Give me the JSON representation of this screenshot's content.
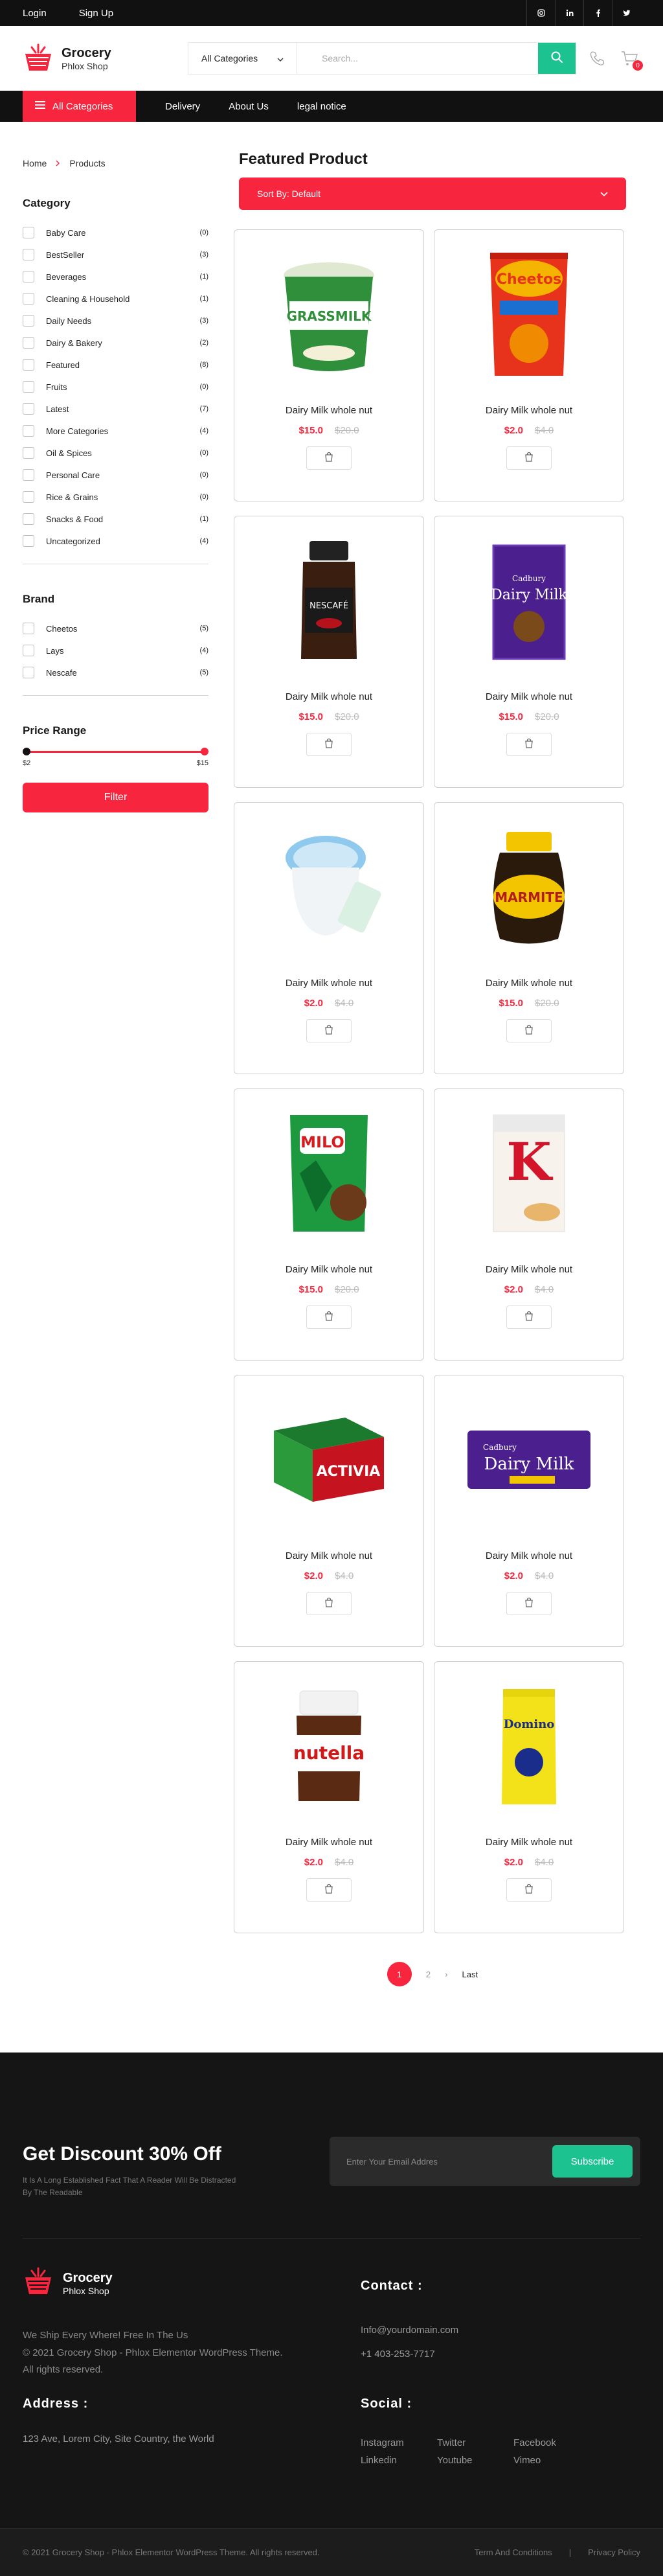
{
  "topbar": {
    "login": "Login",
    "signup": "Sign Up",
    "socials": [
      "instagram-icon",
      "linkedin-icon",
      "facebook-icon",
      "twitter-icon"
    ]
  },
  "header": {
    "logo_title": "Grocery",
    "logo_sub": "Phlox Shop",
    "category_select": "All Categories",
    "search_placeholder": "Search...",
    "cart_count": "0"
  },
  "nav": {
    "all_categories": "All Categories",
    "items": [
      "Delivery",
      "About Us",
      "legal notice"
    ]
  },
  "breadcrumb": {
    "home": "Home",
    "current": "Products"
  },
  "sidebar": {
    "category_title": "Category",
    "categories": [
      {
        "label": "Baby Care",
        "count": "(0)"
      },
      {
        "label": "BestSeller",
        "count": "(3)"
      },
      {
        "label": "Beverages",
        "count": "(1)"
      },
      {
        "label": "Cleaning & Household",
        "count": "(1)"
      },
      {
        "label": "Daily Needs",
        "count": "(3)"
      },
      {
        "label": "Dairy & Bakery",
        "count": "(2)"
      },
      {
        "label": "Featured",
        "count": "(8)"
      },
      {
        "label": "Fruits",
        "count": "(0)"
      },
      {
        "label": "Latest",
        "count": "(7)"
      },
      {
        "label": "More Categories",
        "count": "(4)"
      },
      {
        "label": "Oil & Spices",
        "count": "(0)"
      },
      {
        "label": "Personal Care",
        "count": "(0)"
      },
      {
        "label": "Rice & Grains",
        "count": "(0)"
      },
      {
        "label": "Snacks & Food",
        "count": "(1)"
      },
      {
        "label": "Uncategorized",
        "count": "(4)"
      }
    ],
    "brand_title": "Brand",
    "brands": [
      {
        "label": "Cheetos",
        "count": "(5)"
      },
      {
        "label": "Lays",
        "count": "(4)"
      },
      {
        "label": "Nescafe",
        "count": "(5)"
      }
    ],
    "price_title": "Price Range",
    "price_min": "$2",
    "price_max": "$15",
    "filter_button": "Filter"
  },
  "content": {
    "title": "Featured Product",
    "sort_label": "Sort By: Default"
  },
  "products": [
    {
      "name": "Dairy Milk whole nut",
      "price": "$15.0",
      "old_price": "$20.0",
      "image": "grassmilk-tub"
    },
    {
      "name": "Dairy Milk whole nut",
      "price": "$2.0",
      "old_price": "$4.0",
      "image": "cheetos-bag"
    },
    {
      "name": "Dairy Milk whole nut",
      "price": "$15.0",
      "old_price": "$20.0",
      "image": "nescafe-jar"
    },
    {
      "name": "Dairy Milk whole nut",
      "price": "$15.0",
      "old_price": "$20.0",
      "image": "dairymilk-box"
    },
    {
      "name": "Dairy Milk whole nut",
      "price": "$2.0",
      "old_price": "$4.0",
      "image": "blue-jar"
    },
    {
      "name": "Dairy Milk whole nut",
      "price": "$15.0",
      "old_price": "$20.0",
      "image": "marmite-jar"
    },
    {
      "name": "Dairy Milk whole nut",
      "price": "$15.0",
      "old_price": "$20.0",
      "image": "milo-pouch"
    },
    {
      "name": "Dairy Milk whole nut",
      "price": "$2.0",
      "old_price": "$4.0",
      "image": "special-k-box"
    },
    {
      "name": "Dairy Milk whole nut",
      "price": "$2.0",
      "old_price": "$4.0",
      "image": "activia-pack"
    },
    {
      "name": "Dairy Milk whole nut",
      "price": "$2.0",
      "old_price": "$4.0",
      "image": "dairymilk-bar"
    },
    {
      "name": "Dairy Milk whole nut",
      "price": "$2.0",
      "old_price": "$4.0",
      "image": "nutella-jar"
    },
    {
      "name": "Dairy Milk whole nut",
      "price": "$2.0",
      "old_price": "$4.0",
      "image": "domino-sugar"
    }
  ],
  "pager": {
    "current": "1",
    "next_page": "2",
    "arrow": "›",
    "last": "Last"
  },
  "footer": {
    "discount_title": "Get Discount 30% Off",
    "discount_sub": "It Is A Long Established Fact That A Reader Will Be Distracted By The Readable",
    "email_placeholder": "Enter Your Email Addres",
    "subscribe": "Subscribe",
    "logo_title": "Grocery",
    "logo_sub": "Phlox Shop",
    "tagline": "We Ship Every Where! Free In The Us",
    "copy_line1": "© 2021 Grocery Shop - Phlox Elementor WordPress Theme.",
    "copy_line2": "All rights reserved.",
    "address_title": "Address :",
    "address": "123 Ave, Lorem City, Site Country, the World",
    "contact_title": "Contact :",
    "email": "Info@yourdomain.com",
    "phone": "+1 403-253-7717",
    "social_title": "Social :",
    "social_links": [
      "Instagram",
      "Twitter",
      "Facebook",
      "Linkedin",
      "Youtube",
      "Vimeo"
    ],
    "bottom_copy": "© 2021 Grocery Shop - Phlox Elementor WordPress Theme. All rights reserved.",
    "terms": "Term And Conditions",
    "privacy": "Privacy Policy",
    "separator": "|"
  },
  "colors": {
    "accent": "#f7253e",
    "green": "#1dc291",
    "dark": "#111111"
  }
}
